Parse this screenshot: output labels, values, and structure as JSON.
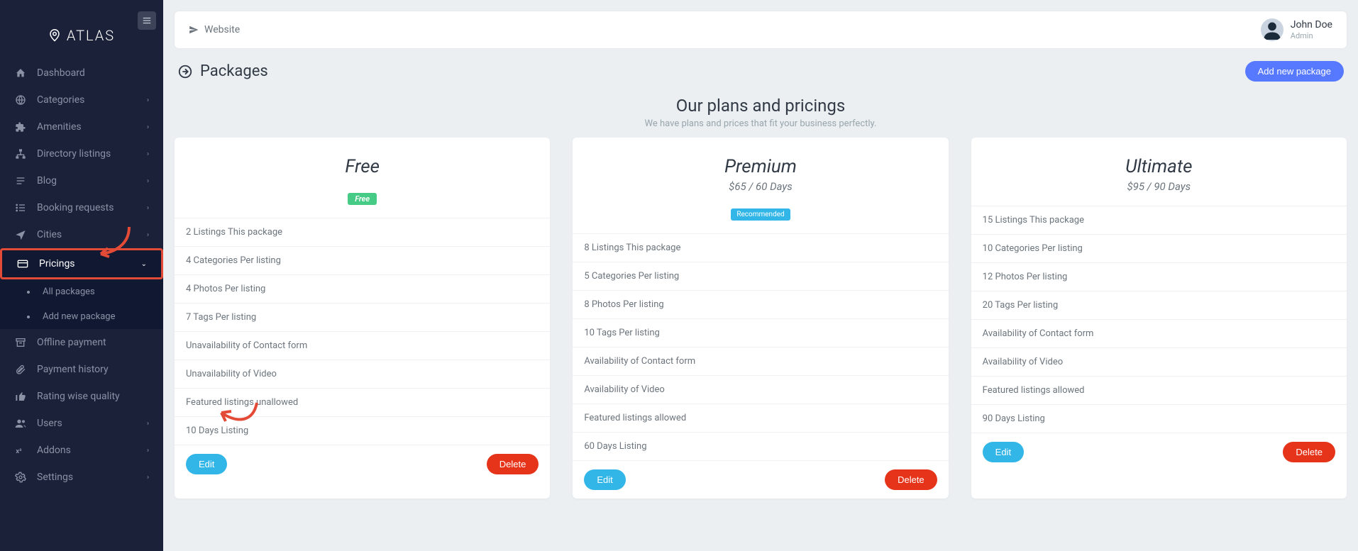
{
  "brand": "ATLAS",
  "topbar": {
    "website": "Website"
  },
  "user": {
    "name": "John Doe",
    "role": "Admin"
  },
  "page": {
    "title": "Packages",
    "add_button": "Add new package"
  },
  "section": {
    "title": "Our plans and pricings",
    "subtitle": "We have plans and prices that fit your business perfectly."
  },
  "nav": {
    "dashboard": "Dashboard",
    "categories": "Categories",
    "amenities": "Amenities",
    "directory_listings": "Directory listings",
    "blog": "Blog",
    "booking_requests": "Booking requests",
    "cities": "Cities",
    "pricings": "Pricings",
    "pricings_sub": {
      "all_packages": "All packages",
      "add_new": "Add new package"
    },
    "offline_payment": "Offline payment",
    "payment_history": "Payment history",
    "rating": "Rating wise quality",
    "users": "Users",
    "addons": "Addons",
    "settings": "Settings"
  },
  "buttons": {
    "edit": "Edit",
    "delete": "Delete"
  },
  "plans": [
    {
      "name": "Free",
      "price": "",
      "badge": "Free",
      "badge_class": "badge-free",
      "features": [
        "2 Listings This package",
        "4 Categories Per listing",
        "4 Photos Per listing",
        "7 Tags Per listing",
        "Unavailability of Contact form",
        "Unavailability of Video",
        "Featured listings unallowed",
        "10 Days Listing"
      ]
    },
    {
      "name": "Premium",
      "price": "$65 / 60 Days",
      "badge": "Recommended",
      "badge_class": "badge-rec",
      "features": [
        "8 Listings This package",
        "5 Categories Per listing",
        "8 Photos Per listing",
        "10 Tags Per listing",
        "Availability of Contact form",
        "Availability of Video",
        "Featured listings allowed",
        "60 Days Listing"
      ]
    },
    {
      "name": "Ultimate",
      "price": "$95 / 90 Days",
      "badge": "",
      "badge_class": "",
      "features": [
        "15 Listings This package",
        "10 Categories Per listing",
        "12 Photos Per listing",
        "20 Tags Per listing",
        "Availability of Contact form",
        "Availability of Video",
        "Featured listings allowed",
        "90 Days Listing"
      ]
    }
  ]
}
